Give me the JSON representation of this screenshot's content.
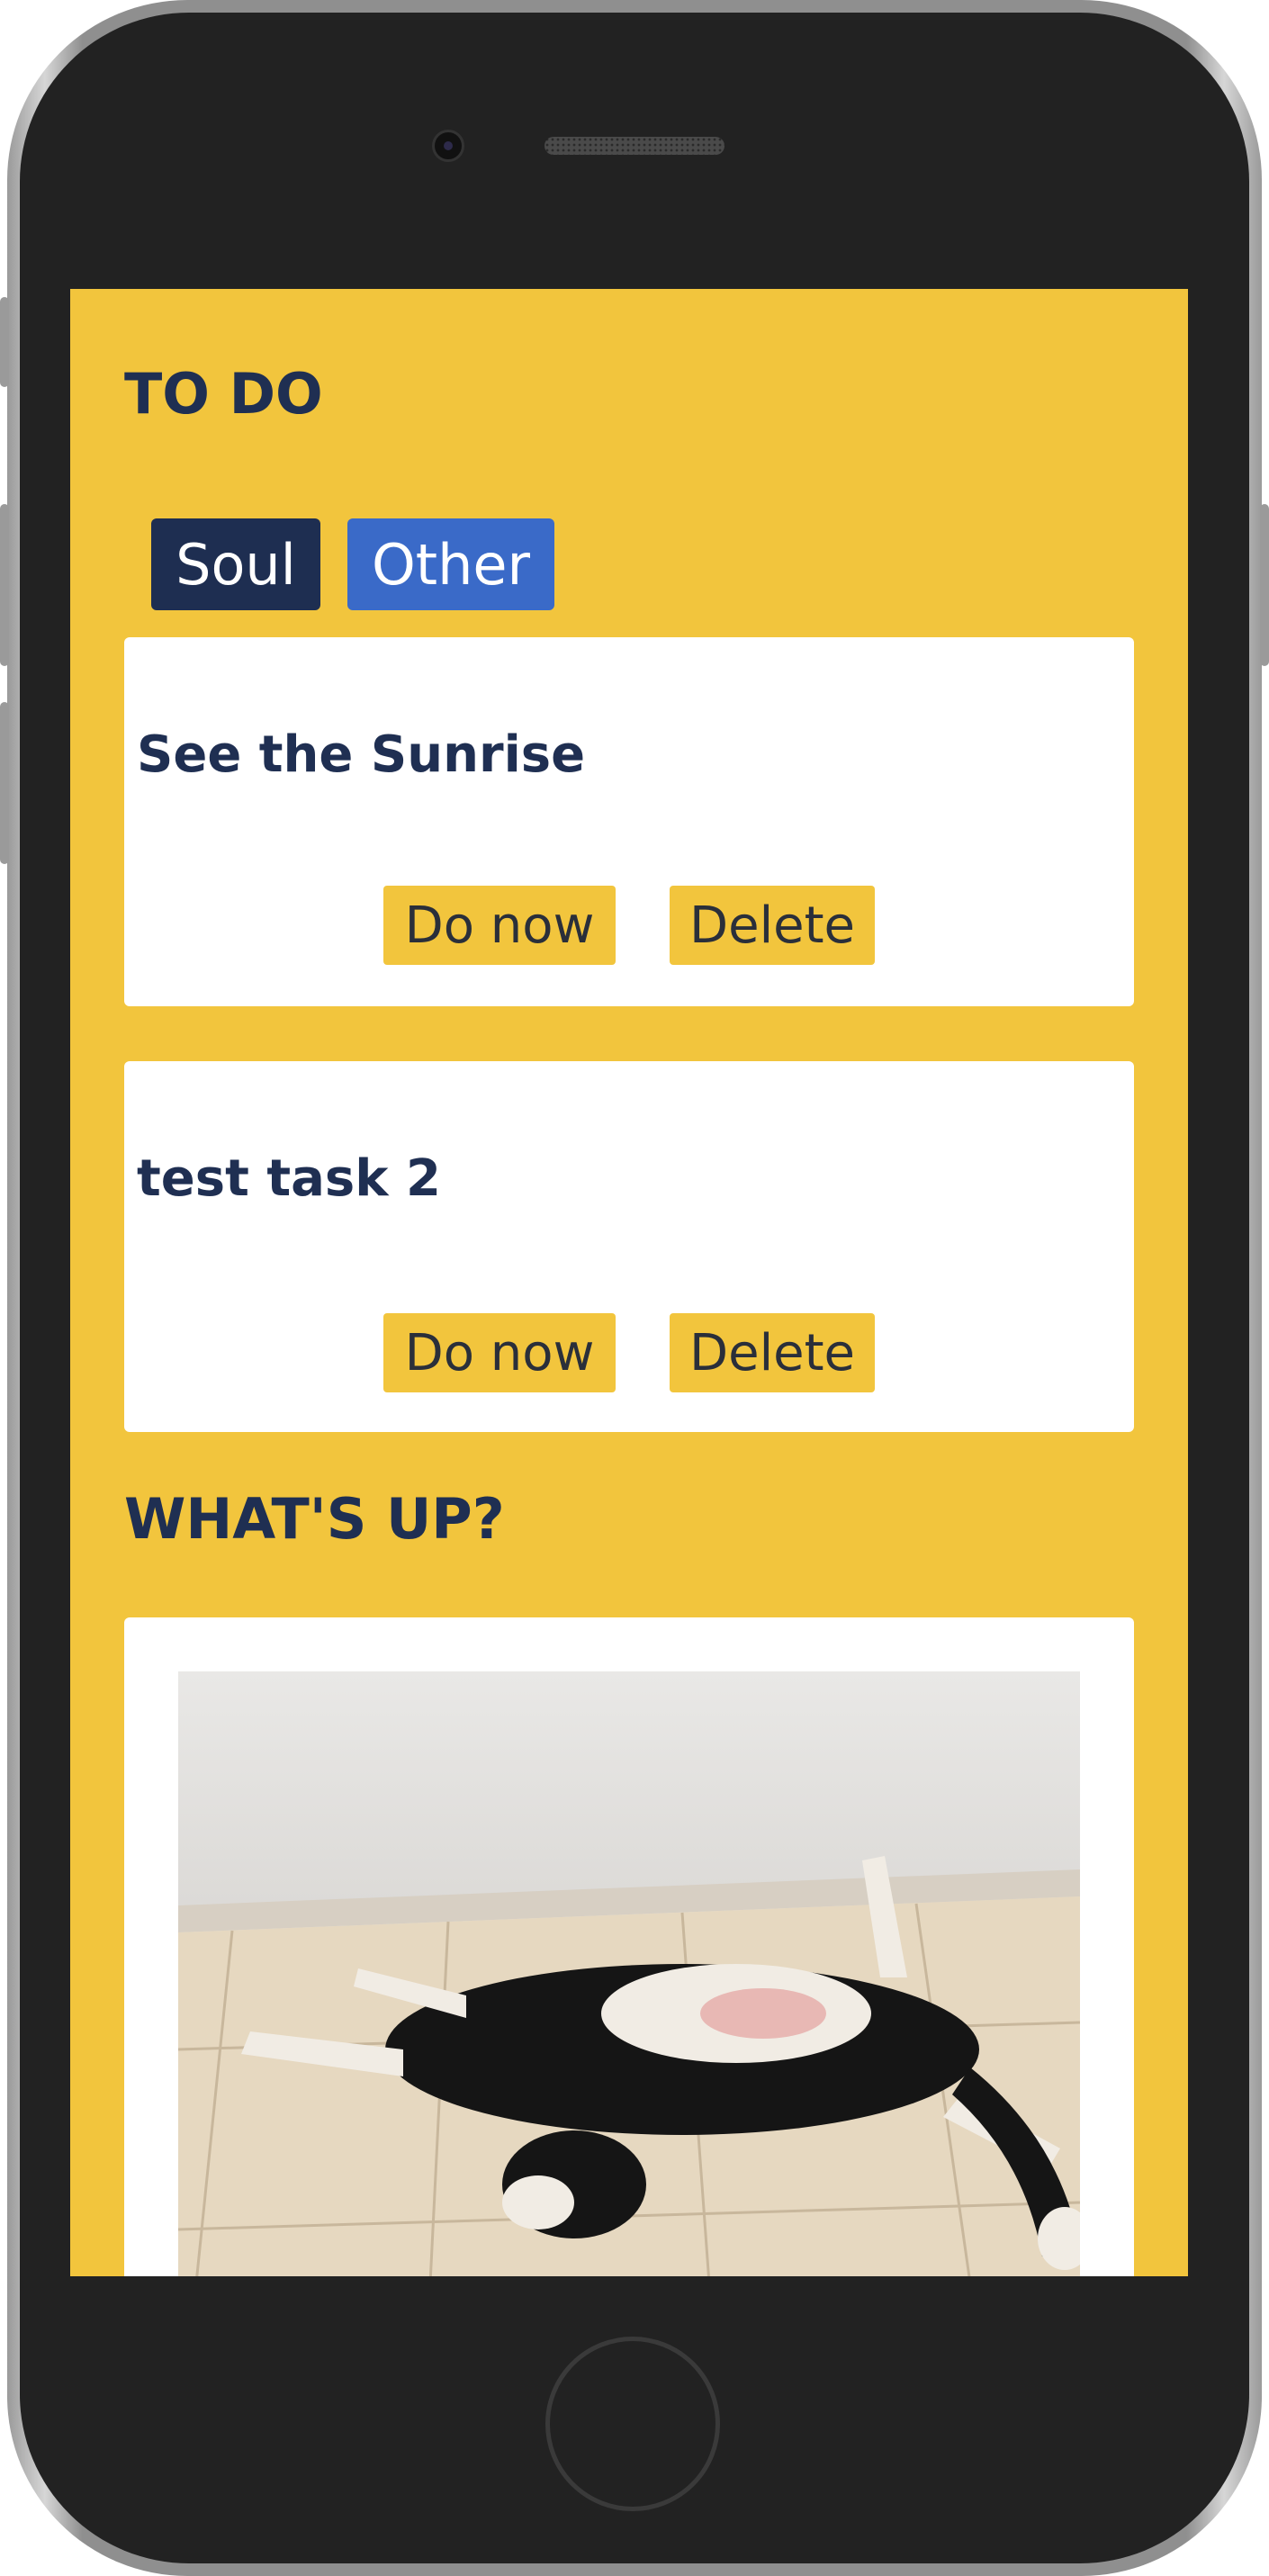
{
  "app": {
    "todo_heading": "TO DO",
    "whats_up_heading": "WHAT'S UP?"
  },
  "filters": [
    {
      "label": "Soul",
      "active": true
    },
    {
      "label": "Other",
      "active": false
    }
  ],
  "tasks": [
    {
      "title": "See the Sunrise",
      "do_now_label": "Do now",
      "delete_label": "Delete"
    },
    {
      "title": "test task 2",
      "do_now_label": "Do now",
      "delete_label": "Delete"
    }
  ],
  "colors": {
    "background": "#f2c53d",
    "text_primary": "#1f2f52",
    "tab_active": "#1e2e51",
    "tab_other": "#3a6ac8",
    "button_bg": "#f2c53d"
  },
  "icons": {
    "photo": "dog-photo"
  }
}
